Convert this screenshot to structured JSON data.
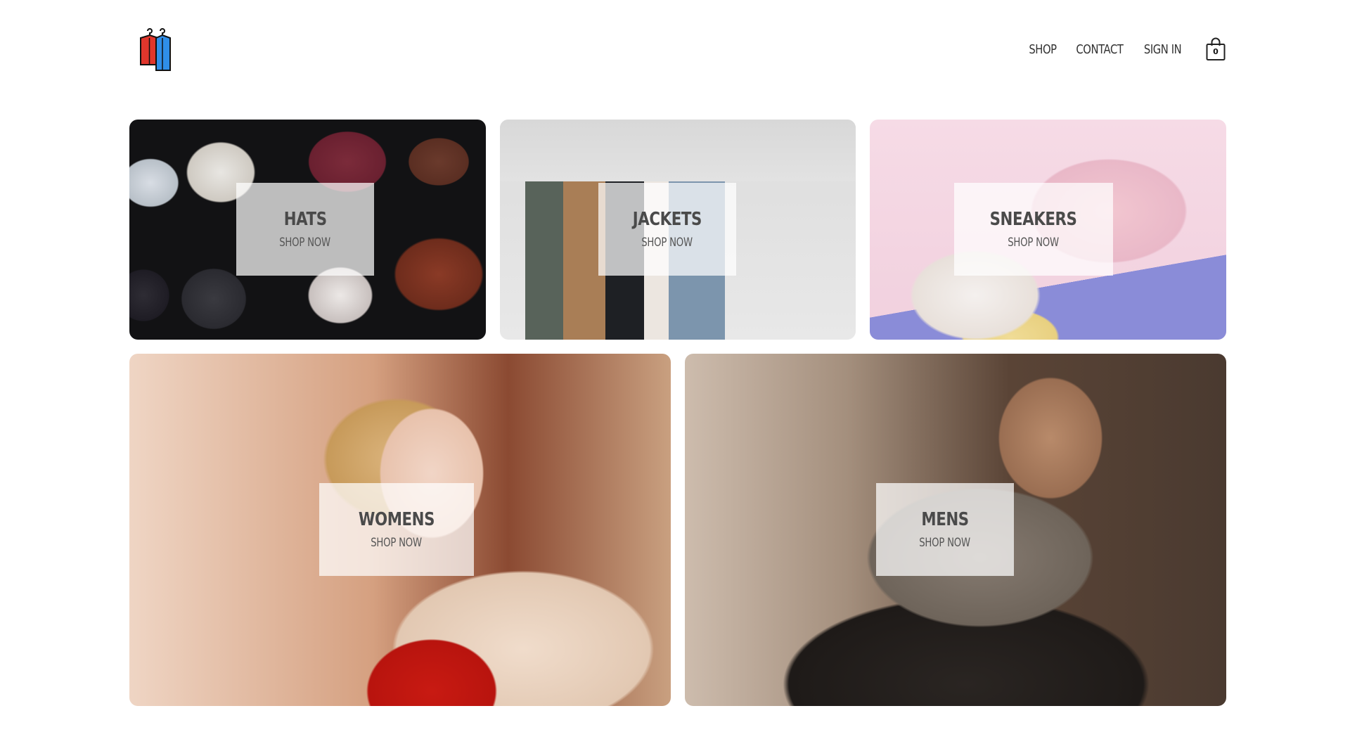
{
  "header": {
    "logo_name": "clothes-rack-logo",
    "nav": [
      {
        "label": "SHOP"
      },
      {
        "label": "CONTACT"
      },
      {
        "label": "SIGN IN"
      }
    ],
    "cart": {
      "icon": "shopping-bag-icon",
      "count": "0"
    }
  },
  "directory": {
    "items": [
      {
        "title": "HATS",
        "subtitle": "SHOP NOW"
      },
      {
        "title": "JACKETS",
        "subtitle": "SHOP NOW"
      },
      {
        "title": "SNEAKERS",
        "subtitle": "SHOP NOW"
      },
      {
        "title": "WOMENS",
        "subtitle": "SHOP NOW"
      },
      {
        "title": "MENS",
        "subtitle": "SHOP NOW"
      }
    ]
  },
  "colors": {
    "text": "#4a4a4a",
    "card_overlay": "#ffffff",
    "logo_red": "#e0362c",
    "logo_blue": "#2f8ee8"
  }
}
